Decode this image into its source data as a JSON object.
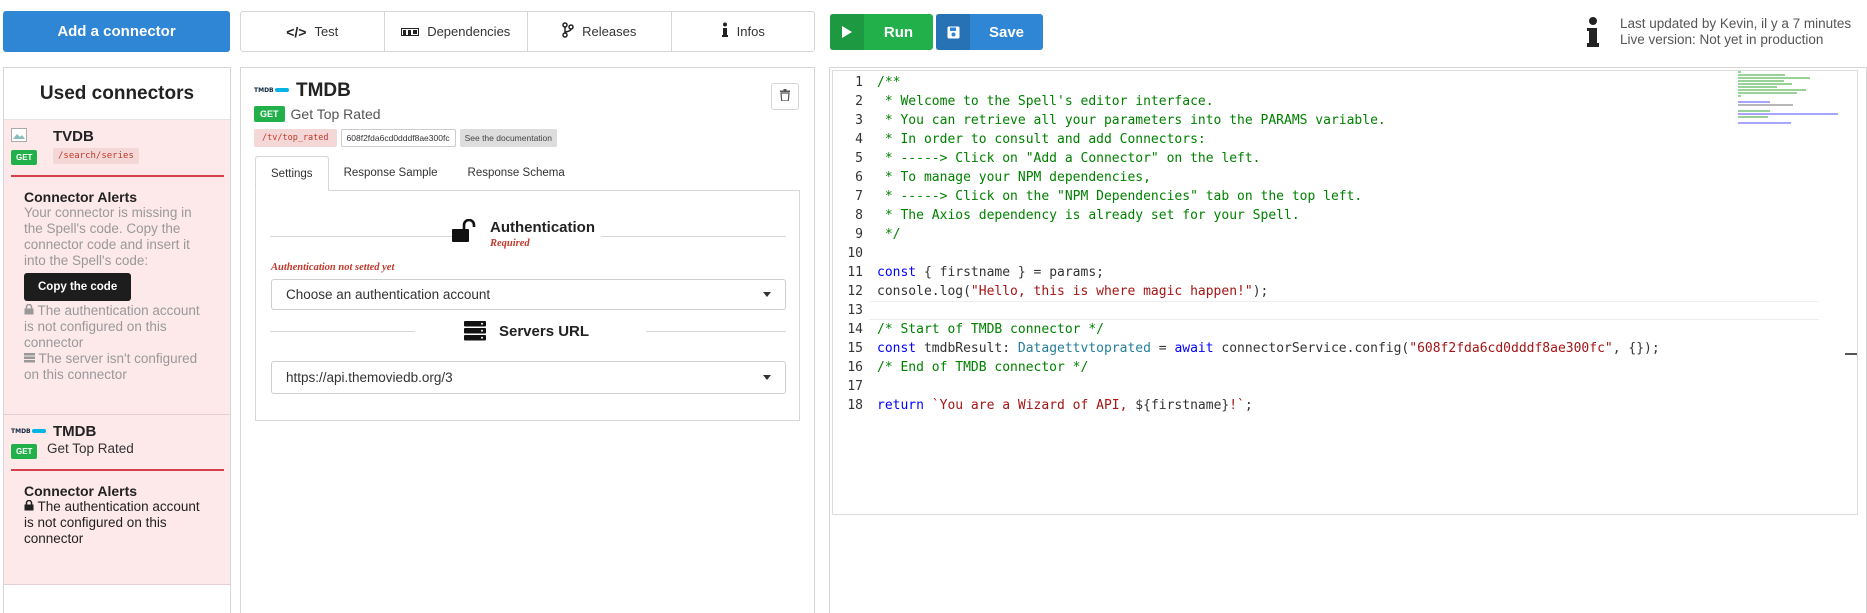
{
  "topbar": {
    "add_connector": "Add a connector",
    "tabs": [
      {
        "label": "Test",
        "icon": "code-icon"
      },
      {
        "label": "Dependencies",
        "icon": "npm-icon"
      },
      {
        "label": "Releases",
        "icon": "branch-icon"
      },
      {
        "label": "Infos",
        "icon": "info-icon"
      }
    ],
    "run": "Run",
    "save": "Save",
    "status_line1": "Last updated by Kevin, il y a 7 minutes",
    "status_line2": "Live version: Not yet in production"
  },
  "sidebar": {
    "title": "Used connectors",
    "cards": [
      {
        "name": "TVDB",
        "method": "GET",
        "path": "/search/series",
        "alert_title": "Connector Alerts",
        "alert_missing": "Your connector is missing in the Spell's code. Copy the connector code and insert it into the Spell's code:",
        "copy_label": "Copy the code",
        "alert_auth": "The authentication account is not configured on this connector",
        "alert_server": "The server isn't configured on this connector"
      },
      {
        "name": "TMDB",
        "method": "GET",
        "endpoint": "Get Top Rated",
        "alert_title": "Connector Alerts",
        "alert_auth": "The authentication account is not configured on this connector"
      }
    ]
  },
  "detail": {
    "name": "TMDB",
    "method": "GET",
    "endpoint": "Get Top Rated",
    "path": "/tv/top_rated",
    "connector_id": "608f2fda6cd0dddf8ae300fc",
    "doc_label": "See the documentation",
    "tabs": [
      "Settings",
      "Response Sample",
      "Response Schema"
    ],
    "auth_title": "Authentication",
    "auth_required": "Required",
    "auth_warning": "Authentication not setted yet",
    "auth_select": "Choose an authentication account",
    "servers_title": "Servers URL",
    "server_select": "https://api.themoviedb.org/3"
  },
  "editor": {
    "lines": [
      [
        {
          "t": "/**",
          "c": "cmt"
        }
      ],
      [
        {
          "t": " * Welcome to the Spell's editor interface.",
          "c": "cmt"
        }
      ],
      [
        {
          "t": " * You can retrieve all your parameters into the PARAMS variable.",
          "c": "cmt"
        }
      ],
      [
        {
          "t": " * In order to consult and add Connectors:",
          "c": "cmt"
        }
      ],
      [
        {
          "t": " * -----> Click on \"Add a Connector\" on the left.",
          "c": "cmt"
        }
      ],
      [
        {
          "t": " * To manage your NPM dependencies,",
          "c": "cmt"
        }
      ],
      [
        {
          "t": " * -----> Click on the \"NPM Dependencies\" tab on the top left.",
          "c": "cmt"
        }
      ],
      [
        {
          "t": " * The Axios dependency is already set for your Spell.",
          "c": "cmt"
        }
      ],
      [
        {
          "t": " */",
          "c": "cmt"
        }
      ],
      [],
      [
        {
          "t": "const",
          "c": "kw"
        },
        {
          "t": " { firstname } = params;",
          "c": ""
        }
      ],
      [
        {
          "t": "console.log(",
          "c": ""
        },
        {
          "t": "\"Hello, this is where magic happen!\"",
          "c": "str"
        },
        {
          "t": ");",
          "c": ""
        }
      ],
      [],
      [
        {
          "t": "/* Start of TMDB connector */",
          "c": "cmt"
        }
      ],
      [
        {
          "t": "const",
          "c": "kw"
        },
        {
          "t": " tmdbResult: ",
          "c": ""
        },
        {
          "t": "Datagettvtoprated",
          "c": "typ"
        },
        {
          "t": " = ",
          "c": ""
        },
        {
          "t": "await",
          "c": "kw"
        },
        {
          "t": " connectorService.config(",
          "c": ""
        },
        {
          "t": "\"608f2fda6cd0dddf8ae300fc\"",
          "c": "str"
        },
        {
          "t": ", {});",
          "c": ""
        }
      ],
      [
        {
          "t": "/* End of TMDB connector */",
          "c": "cmt"
        }
      ],
      [],
      [
        {
          "t": "return",
          "c": "kw"
        },
        {
          "t": " ",
          "c": ""
        },
        {
          "t": "`You are a Wizard of API, ",
          "c": "str"
        },
        {
          "t": "${firstname}",
          "c": ""
        },
        {
          "t": "!`",
          "c": "str"
        },
        {
          "t": ";",
          "c": ""
        }
      ]
    ]
  },
  "colors": {
    "primary": "#2e86d4",
    "run_green": "#22b04a",
    "alert_bg": "#fde8ea",
    "alert_red": "#d43f4a"
  }
}
